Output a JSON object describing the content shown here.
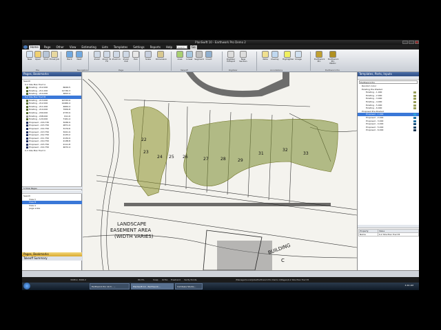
{
  "app": {
    "title": "PlanSwift 10 - Earthwork Pro Demo 2"
  },
  "menu": [
    "Home",
    "Page",
    "Other",
    "View",
    "Estimating",
    "Lists",
    "Templates",
    "Settings",
    "Reports",
    "Help"
  ],
  "menu_active": "Home",
  "search": {
    "placeholder": "Search",
    "button": "Go"
  },
  "ribbon": {
    "buttons": [
      "New",
      "Open",
      "Print",
      "Email Job",
      "Back",
      "Next",
      "Zoom",
      "Zoom To Fit",
      "Zoom In",
      "Zoom Out",
      "Pan",
      "Scale",
      "Dimension",
      "Area",
      "Linear",
      "Segment",
      "Count",
      "Digitizer Hotspot",
      "New Section",
      "Note",
      "Overlay",
      "Highlighter",
      "Image",
      "Earthwork Pro",
      "Earthwork Pro Metric"
    ],
    "groups": [
      "File",
      "Navigation",
      "Page",
      "Takeoff",
      "Digitizer",
      "Annotations",
      "Earthwork Pro"
    ]
  },
  "left_panel": {
    "title": "Pages, Bookmarks",
    "tree_root": "Search",
    "pages": [
      {
        "label": "0-2 Site Plan Tract A",
        "value": "",
        "color": "#ffffff",
        "sel": false,
        "hdr": true
      },
      {
        "label": "Existing - 212.000",
        "value": "6649.5",
        "color": "#556b2f",
        "sel": false
      },
      {
        "label": "Existing - 211.000",
        "value": "11730.3",
        "color": "#556b2f",
        "sel": false
      },
      {
        "label": "Existing - 210.000",
        "value": "3653.4",
        "color": "#556b2f",
        "sel": false
      },
      {
        "label": "0-2 Site Plan Tract B",
        "value": "",
        "color": "#ffffff",
        "sel": true,
        "hdr": true
      },
      {
        "label": "Existing - 213.000",
        "value": "10733.9",
        "color": "#556b2f",
        "sel": false
      },
      {
        "label": "Existing - 212.000",
        "value": "12460.4",
        "color": "#556b2f",
        "sel": false
      },
      {
        "label": "Existing - 211.000",
        "value": "4664.4",
        "color": "#556b2f",
        "sel": false
      },
      {
        "label": "Existing - 210.000",
        "value": "7959.8",
        "color": "#556b2f",
        "sel": false
      },
      {
        "label": "Existing - 209.000",
        "value": "2733.9",
        "color": "#556b2f",
        "sel": false
      },
      {
        "label": "Existing - 208.000",
        "value": "611.6",
        "color": "#8a8a8a",
        "sel": false
      },
      {
        "label": "Existing - 120.000",
        "value": "7161.4",
        "color": "#556b2f",
        "sel": false
      },
      {
        "label": "Proposed - 216.730",
        "value": "3436.9",
        "color": "#1b2b5e",
        "sel": false
      },
      {
        "label": "Proposed - 215.750",
        "value": "2871.9",
        "color": "#1b2b5e",
        "sel": false
      },
      {
        "label": "Proposed - 214.750",
        "value": "3174.6",
        "color": "#1b2b5e",
        "sel": false
      },
      {
        "label": "Proposed - 213.750",
        "value": "3221.9",
        "color": "#1b2b5e",
        "sel": false
      },
      {
        "label": "Proposed - 212.750",
        "value": "2133.2",
        "color": "#1b2b5e",
        "sel": false
      },
      {
        "label": "Proposed - 211.750",
        "value": "2134.9",
        "color": "#1b2b5e",
        "sel": false
      },
      {
        "label": "Proposed - 210.750",
        "value": "2138.8",
        "color": "#1b2b5e",
        "sel": false
      },
      {
        "label": "Proposed - 215.750",
        "value": "2111.8",
        "color": "#1b2b5e",
        "sel": false
      },
      {
        "label": "Proposed - 214.750",
        "value": "4672.4",
        "color": "#1b2b5e",
        "sel": false
      },
      {
        "label": "0-3 Site Plan Tract C",
        "value": "",
        "color": "#ffffff",
        "sel": false,
        "hdr": true
      }
    ],
    "total_pages": "5 Total Pages",
    "views_root": "Search",
    "views": [
      {
        "label": "View C",
        "sel": false
      },
      {
        "label": "View B",
        "sel": true
      },
      {
        "label": "View A",
        "sel": false
      },
      {
        "label": "page scale",
        "sel": false
      }
    ],
    "bottom_tabs": [
      "Pages, Bookmarks",
      "Takeoff Summary"
    ]
  },
  "right_panel": {
    "title": "Templates, Parts, Inputs",
    "dropdown": "Earthwork Pro",
    "items": [
      {
        "label": "Random Color",
        "color": "#ffffff",
        "sel": false,
        "hdr": true
      },
      {
        "label": "Existing Pre-Shaded",
        "color": "#ffffff",
        "sel": false,
        "hdr": true
      },
      {
        "label": "Existing - 1.000",
        "color": "#9aa05a",
        "sel": false
      },
      {
        "label": "Existing - 2.000",
        "color": "#9aa05a",
        "sel": false
      },
      {
        "label": "Existing - 3.000",
        "color": "#9aa05a",
        "sel": false
      },
      {
        "label": "Existing - 4.000",
        "color": "#9aa05a",
        "sel": false
      },
      {
        "label": "Existing - 5.000",
        "color": "#9aa05a",
        "sel": false
      },
      {
        "label": "Existing - 6.000",
        "color": "#9aa05a",
        "sel": false
      },
      {
        "label": "Proposed Pre-Shaded",
        "color": "#ffffff",
        "sel": false,
        "hdr": true
      },
      {
        "label": "Proposed - 1.000",
        "color": "#2aa3d8",
        "sel": true
      },
      {
        "label": "Proposed - 2.000",
        "color": "#1f6fa0",
        "sel": false
      },
      {
        "label": "Proposed - 3.000",
        "color": "#1f6fa0",
        "sel": false
      },
      {
        "label": "Proposed - 4.000",
        "color": "#1f5580",
        "sel": false
      },
      {
        "label": "Proposed - 5.000",
        "color": "#1a4466",
        "sel": false
      },
      {
        "label": "Proposed - 6.000",
        "color": "#153450",
        "sel": false
      }
    ],
    "props_headers": [
      "Property",
      "Value"
    ],
    "props": [
      [
        "Name",
        "0-2 Site Plan Tract B"
      ]
    ]
  },
  "canvas": {
    "labels": [
      "LANDSCAPE",
      "EASEMENT AREA",
      "(WIDTH VARIES)",
      "BUILDING",
      "C"
    ],
    "lot_numbers": [
      "22",
      "23",
      "24",
      "25",
      "26",
      "27",
      "28",
      "29",
      "31",
      "32",
      "33"
    ]
  },
  "status": {
    "coords": "3998.2, 3006.2",
    "zoom": "89.3%",
    "toggles": [
      "Snap",
      "Ortho",
      "Freehand",
      "Verify Points"
    ],
    "path": "\\Manager\\Local\\Jobs\\Earthwork Pro Demo 2\\Pages\\0-2 Site Plan Tract B"
  },
  "taskbar": {
    "items": [
      "Earthwork Pro 10.3 - ...",
      "PlanSwift 10 - Earthwork...",
      "Camtasia Studio..."
    ],
    "time": "4:44 AM"
  },
  "colors": {
    "existing_fill": "#8a8f2a",
    "proposed_fill": "#7a8a30",
    "selection": "#3a78d8",
    "title_blue": "#2d4d84"
  }
}
